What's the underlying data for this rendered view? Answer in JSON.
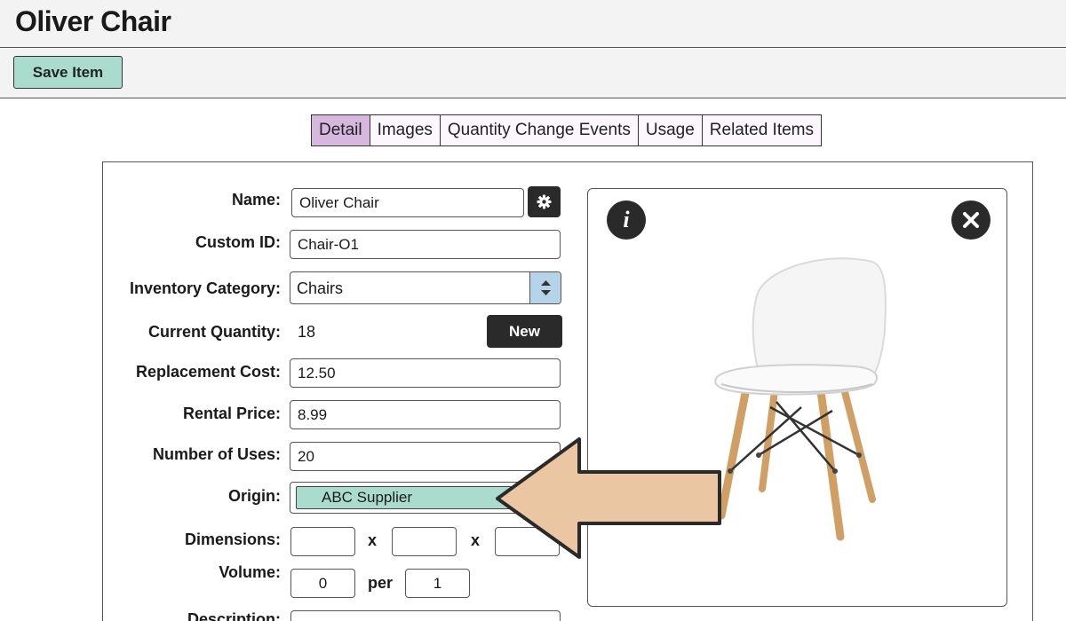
{
  "page": {
    "title": "Oliver Chair"
  },
  "toolbar": {
    "save_label": "Save Item"
  },
  "tabs": [
    {
      "label": "Detail",
      "active": true
    },
    {
      "label": "Images",
      "active": false
    },
    {
      "label": "Quantity Change Events",
      "active": false
    },
    {
      "label": "Usage",
      "active": false
    },
    {
      "label": "Related Items",
      "active": false
    }
  ],
  "form": {
    "name": {
      "label": "Name:",
      "value": "Oliver Chair"
    },
    "custom_id": {
      "label": "Custom ID:",
      "value": "Chair-O1"
    },
    "inventory_category": {
      "label": "Inventory Category:",
      "value": "Chairs"
    },
    "current_quantity": {
      "label": "Current Quantity:",
      "value": "18",
      "new_label": "New"
    },
    "replacement_cost": {
      "label": "Replacement Cost:",
      "value": "12.50"
    },
    "rental_price": {
      "label": "Rental Price:",
      "value": "8.99"
    },
    "number_of_uses": {
      "label": "Number of Uses:",
      "value": "20"
    },
    "origin": {
      "label": "Origin:",
      "value": "ABC Supplier"
    },
    "dimensions": {
      "label": "Dimensions:",
      "sep": "x",
      "length": "",
      "width": "",
      "height": ""
    },
    "volume": {
      "label": "Volume:",
      "value": "0",
      "per_label": "per",
      "per_value": "1"
    },
    "description": {
      "label": "Description:"
    }
  },
  "image_panel": {
    "info_glyph": "i"
  },
  "colors": {
    "accent_green": "#a9dccd",
    "active_tab": "#d6b7dd",
    "arrow_fill": "#ebc6a3",
    "dark_button": "#2a2a2a",
    "select_arrows": "#b5d4ea"
  }
}
